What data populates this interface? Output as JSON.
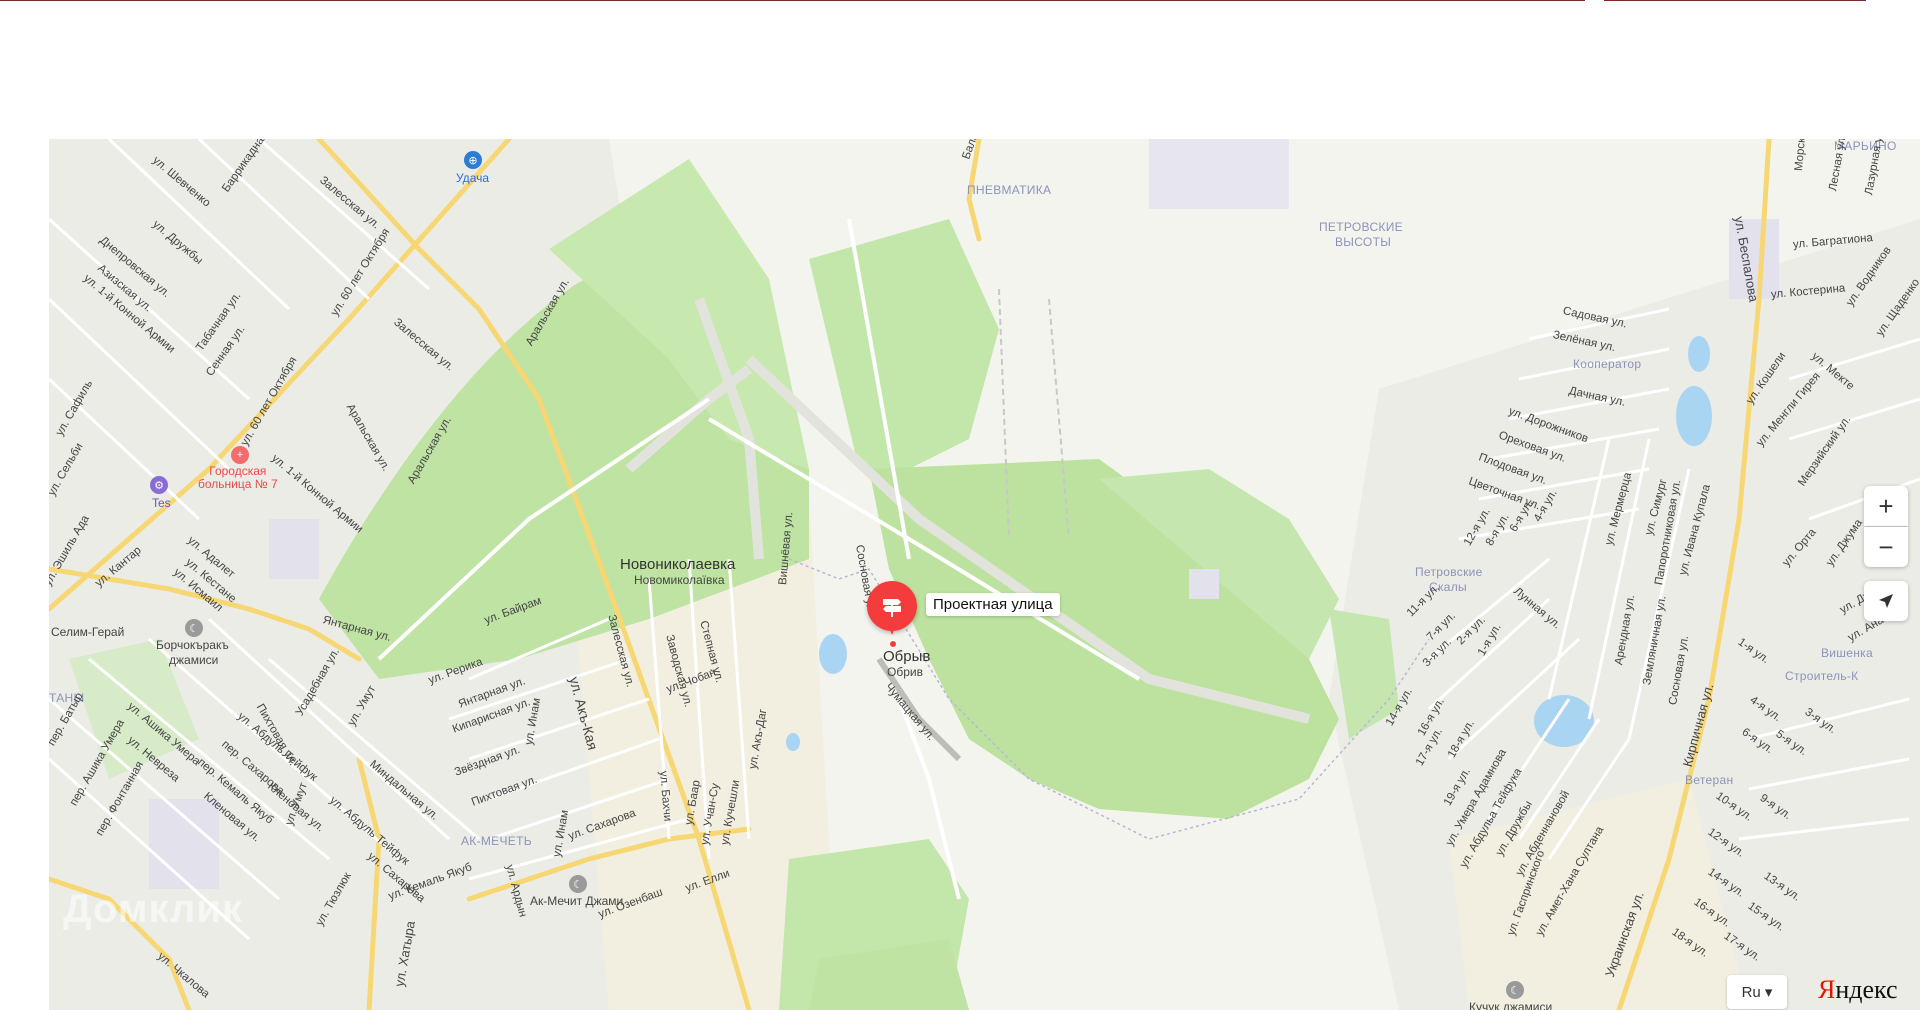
{
  "pin": {
    "label": "Проектная улица"
  },
  "places": {
    "obryv": "Обрыв",
    "obryv_sub": "Обрив",
    "novonikolaevka": "Новониколаевка",
    "novonikolaevka_sub": "Новомиколаївка"
  },
  "districts": {
    "pnevmatika": "ПНЕВМАТИКА",
    "petrovskie_vysoty_1": "ПЕТРОВСКИЕ",
    "petrovskie_vysoty_2": "ВЫСОТЫ",
    "marino": "МАРЬИНО",
    "kooperator": "Кооператор",
    "petrovskie_skaly_1": "Петровские",
    "petrovskie_skaly_2": "Скалы",
    "vishenka": "Вишенка",
    "stroitel": "Строитель-К",
    "veteran": "Ветеран",
    "ak_mechet": "АК-МЕЧЕТЬ",
    "tany": "ТАНЫ"
  },
  "pois": {
    "udacha": "Удача",
    "hospital_1": "Городская",
    "hospital_2": "больница № 7",
    "tes": "Tes",
    "selim": "Селим-Герай",
    "borchokrak_1": "Борчокъракъ",
    "borchokrak_2": "джамиси",
    "akmechit": "Ак-Мечит Джами",
    "kuchuk": "Кучук джамиси"
  },
  "streets": {
    "s01": "ул. 60 лет Октября",
    "s02": "ул. 60 лет Октября",
    "s03": "Залесская ул.",
    "s04": "Залесская ул.",
    "s05": "Аральская ул.",
    "s06": "Аральская ул.",
    "s07": "ул. 1-й Конной Армии",
    "s08": "ул. 1-й Конной Армии",
    "s09": "ул. Шевченко",
    "s10": "ул. Дружбы",
    "s11": "Днепровская ул.",
    "s12": "Азизская ул.",
    "s13": "Табачная ул.",
    "s14": "Сенная ул.",
    "s15": "Баррикадная ул.",
    "s16": "Янтарная ул.",
    "s17": "ул. Кантар",
    "s18": "ул. Исмаил",
    "s19": "ул. Адалет",
    "s20": "ул. Кестане",
    "s21": "ул. Умут",
    "s22": "ул. Абдуль Тейфук",
    "s23": "ул. Абдуль Тейфук",
    "s24": "ул. Акъ-Кая",
    "s25": "ул. Байрам",
    "s26": "ул. Рерика",
    "s27": "Янтарная ул.",
    "s28": "Кипарисная ул.",
    "s29": "Звёздная ул.",
    "s30": "Пихтовая ул.",
    "s31": "Миндальная ул.",
    "s32": "ул. Сахарова",
    "s33": "ул. Сахарова",
    "s34": "ул. Инам",
    "s35": "ул. Инам",
    "s36": "ул. Кемаль Якуб",
    "s37": "ул. Озенбаш",
    "s38": "ул. Елли",
    "s39": "ул. Чобан",
    "s40": "Заводская ул.",
    "s41": "Степная ул.",
    "s42": "Залесская ул.",
    "s43": "Вишнёвая ул.",
    "s44": "ул. Акъ-Даг",
    "s45": "ул. Бахчи",
    "s46": "ул. Баар",
    "s47": "ул. Учан-Су",
    "s48": "ул. Кучешли",
    "s49": "Сосновая ул.",
    "s50": "Чумацкая ул.",
    "s51": "Балаклавская",
    "s52": "Садовая ул.",
    "s53": "Зелёная ул.",
    "s54": "Дачная ул.",
    "s55": "ул. Дорожников",
    "s56": "Ореховая ул.",
    "s57": "Плодовая ул.",
    "s58": "Цветочная ул.",
    "s59": "Лунная ул.",
    "s60": "ул. Беспалова",
    "s61": "ул. Багратиона",
    "s62": "ул. Костерина",
    "s63": "Кирпичная ул.",
    "s64": "Украинская ул.",
    "s65": "ул. Умера Адамнова",
    "s66": "ул. Абдульа Тейфука",
    "s67": "ул. Дружбы",
    "s68": "ул. Абденнановой",
    "s69": "ул. Гаспринского",
    "s70": "ул. Амет-Хана Султана",
    "s71": "ул. Мермерца",
    "s72": "ул. Симург",
    "s73": "Папоротниковая ул.",
    "s74": "ул. Ивана Купала",
    "s75": "Арендная ул.",
    "s76": "Земляничная ул.",
    "s77": "Сосновая ул.",
    "s78": "12-я ул.",
    "s79": "8-я ул.",
    "s80": "6-я ул.",
    "s81": "4-я ул.",
    "s82": "11-я ул.",
    "s83": "7-я ул.",
    "s84": "3-я ул.",
    "s85": "2-я ул.",
    "s86": "1-я ул.",
    "s87": "14-я ул.",
    "s88": "16-я ул.",
    "s89": "17-я ул.",
    "s90": "18-я ул.",
    "s91": "19-я ул.",
    "s92": "10-я ул.",
    "s93": "9-я ул.",
    "s94": "12-я ул.",
    "s95": "14-я ул.",
    "s96": "13-я ул.",
    "s97": "15-я ул.",
    "s98": "16-я ул.",
    "s99": "17-я ул.",
    "s100": "18-я ул.",
    "s101": "1-я ул.",
    "s102": "3-я ул.",
    "s103": "4-я ул.",
    "s104": "5-я ул.",
    "s105": "6-я ул.",
    "s106": "ул. Мекте",
    "s107": "ул. Водников",
    "s108": "ул. Кошели",
    "s109": "ул. Менгли Гирея",
    "s110": "Мерзийский ул.",
    "s111": "ул. Орта",
    "s112": "ул. Джума",
    "s113": "ул. Джами",
    "s114": "ул. Ана Юрт",
    "s115": "Морская ул.",
    "s116": "Лесная ул.",
    "s117": "Лазурная ул.",
    "s118": "ул. Щаденко",
    "s119": "ул. Ашика Умера",
    "s120": "ул. Невреза",
    "s121": "пер. Кемаль Якуб",
    "s122": "Кленовая ул.",
    "s123": "пер. Ашика Умера",
    "s124": "пер. Фонтанная",
    "s125": "ул. Тюзлюк",
    "s126": "ул. Ардын",
    "s127": "ул. Чкалова",
    "s128": "ул. Хатыра",
    "s129": "Усадебная ул.",
    "s130": "Пихтовая ул.",
    "s131": "пер. Сахарова",
    "s132": "ул. Эшиль Ада",
    "s133": "ул. Сельби",
    "s134": "ул. Сафиль",
    "s135": "пер. Батыр",
    "s136": "Кленовая ул.",
    "s137": "ул. Умут",
    "s138": "Аральская ул."
  },
  "controls": {
    "zoom_in": "+",
    "zoom_out": "−",
    "lang": "Ru ▾",
    "logo_y": "Я",
    "logo_rest": "ндекс"
  },
  "watermark": "Домклик"
}
